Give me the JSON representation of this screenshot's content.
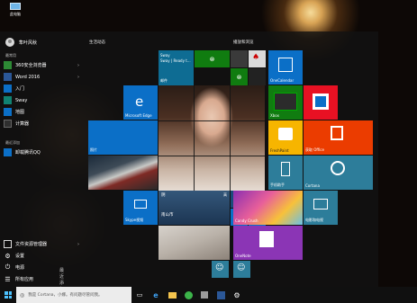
{
  "desktop": {
    "icon_label": "此电脑"
  },
  "user": {
    "name": "隼叶风秋"
  },
  "most_used": {
    "title": "最常用",
    "items": [
      {
        "label": "360安全浏览器",
        "color": "#2d8a35"
      },
      {
        "label": "Word 2016",
        "color": "#2b5797"
      },
      {
        "label": "入门",
        "color": "#0b6fc7"
      },
      {
        "label": "Sway",
        "color": "#108272"
      },
      {
        "label": "地图",
        "color": "#0b6fc7"
      },
      {
        "label": "计算器",
        "color": "#2f2f2f"
      }
    ]
  },
  "recent": {
    "title": "最近添加",
    "items": [
      {
        "label": "卸载腾讯QQ",
        "color": "#0b6fc7"
      }
    ]
  },
  "bottom": {
    "items": [
      {
        "label": "文件资源管理器"
      },
      {
        "label": "设置"
      },
      {
        "label": "电源"
      },
      {
        "label": "所有应用",
        "badge": "最近添加"
      }
    ]
  },
  "groups": {
    "left": "生活动态",
    "right": "播放和浏览"
  },
  "tiles": {
    "sway": {
      "title": "Sway",
      "text": "Sway | Ready t...",
      "footer": "邮件"
    },
    "edge": {
      "label": "Microsoft Edge"
    },
    "photos": {
      "label": "照片"
    },
    "weather": {
      "temp": "阴",
      "city": "南山市",
      "low": "高"
    },
    "skype": {
      "label": "Skype视频"
    },
    "onecalendar": {
      "label": "OneCalendar"
    },
    "xbox": {
      "label": "Xbox"
    },
    "freshpaint": {
      "label": "FreshPaint"
    },
    "getoffice": {
      "label": "获取 Office"
    },
    "office_word": {
      "text": "Office"
    },
    "phone": {
      "label": "手机助手"
    },
    "cortana": {
      "label": "Cortana"
    },
    "candy": {
      "label": "Candy Crush"
    },
    "moviemaker": {
      "label": "电影和电视"
    },
    "onenote": {
      "label": "OneNote"
    }
  },
  "taskbar": {
    "search_placeholder": "我是 Cortana，小娜。有问题尽管问我。"
  },
  "colors": {
    "accent": "#0b6fc7",
    "green": "#107c10",
    "red": "#e81123",
    "office": "#eb3c00",
    "teal": "#2d7d9a",
    "purple": "#8b35b5",
    "yellow": "#f7b500"
  }
}
